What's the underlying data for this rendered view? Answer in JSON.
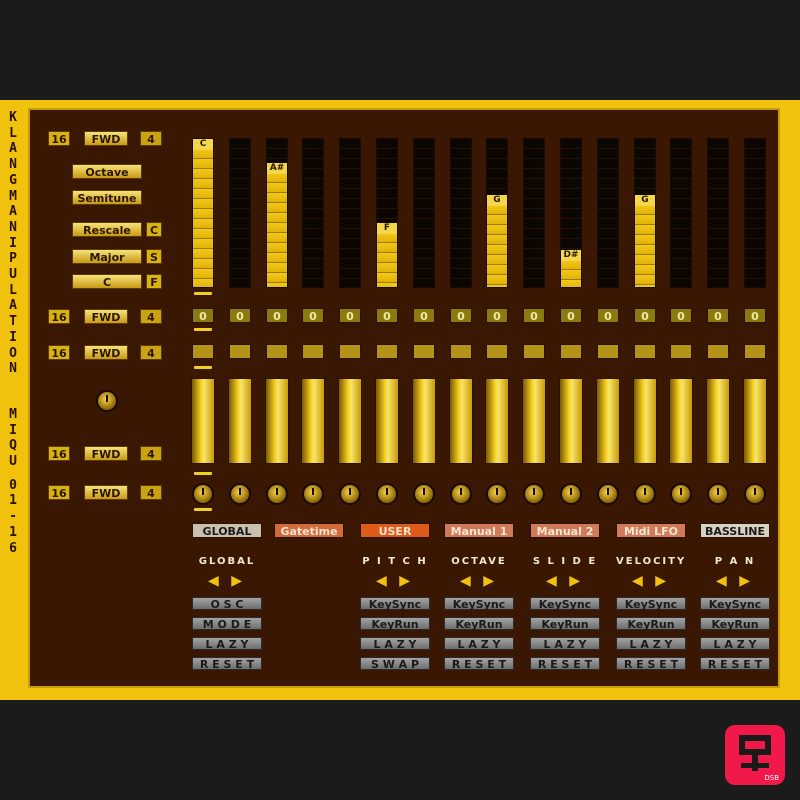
{
  "title_vertical": "KLANGMANIPULATION",
  "subtitle_vertical": "MIQU 01-16",
  "rows": [
    {
      "steps": "16",
      "dir": "FWD",
      "div": "4"
    },
    {
      "steps": "16",
      "dir": "FWD",
      "div": "4"
    },
    {
      "steps": "16",
      "dir": "FWD",
      "div": "4"
    },
    {
      "steps": "16",
      "dir": "FWD",
      "div": "4"
    },
    {
      "steps": "16",
      "dir": "FWD",
      "div": "4"
    }
  ],
  "pitch_controls": {
    "octave": "Octave",
    "semitune": "Semitune",
    "rescale": "Rescale",
    "rescale_key": "C",
    "scale": "Major",
    "scale_key": "S",
    "root": "C",
    "root_key": "F"
  },
  "pitch_steps": [
    {
      "note": "C",
      "level": 1.0
    },
    {
      "note": "",
      "level": 0.0
    },
    {
      "note": "A#",
      "level": 0.84
    },
    {
      "note": "",
      "level": 0.0
    },
    {
      "note": "",
      "level": 0.0
    },
    {
      "note": "F",
      "level": 0.43
    },
    {
      "note": "",
      "level": 0.0
    },
    {
      "note": "",
      "level": 0.0
    },
    {
      "note": "G",
      "level": 0.62
    },
    {
      "note": "",
      "level": 0.0
    },
    {
      "note": "D#",
      "level": 0.25
    },
    {
      "note": "",
      "level": 0.0
    },
    {
      "note": "G",
      "level": 0.62
    },
    {
      "note": "",
      "level": 0.0
    },
    {
      "note": "",
      "level": 0.0
    },
    {
      "note": "",
      "level": 0.0
    }
  ],
  "octave_values": [
    "0",
    "0",
    "0",
    "0",
    "0",
    "0",
    "0",
    "0",
    "0",
    "0",
    "0",
    "0",
    "0",
    "0",
    "0",
    "0"
  ],
  "tabs": [
    {
      "label": "GLOBAL",
      "color": "#c9c0b0",
      "text": "#1a1a1a"
    },
    {
      "label": "Gatetime",
      "color": "#d26a3a",
      "text": "#f4e6d0"
    },
    {
      "label": "USER",
      "color": "#e05a1a",
      "text": "#f4e6d0"
    },
    {
      "label": "Manual 1",
      "color": "#d07a5a",
      "text": "#f4e6d0"
    },
    {
      "label": "Manual 2",
      "color": "#d07a5a",
      "text": "#f4e6d0"
    },
    {
      "label": "Midi LFO",
      "color": "#d07a5a",
      "text": "#f4e6d0"
    },
    {
      "label": "BASSLINE",
      "color": "#d8d0c0",
      "text": "#1a1a1a"
    }
  ],
  "sections": [
    {
      "name": "GLOBAL",
      "buttons": [
        "O S C",
        "M O D E",
        "L A Z Y",
        "R E S E T"
      ]
    },
    {
      "name": "P I T C H",
      "buttons": [
        "KeySync",
        "KeyRun",
        "L A Z Y",
        "S W A P"
      ]
    },
    {
      "name": "OCTAVE",
      "buttons": [
        "KeySync",
        "KeyRun",
        "L A Z Y",
        "R E S E T"
      ]
    },
    {
      "name": "S L I D E",
      "buttons": [
        "KeySync",
        "KeyRun",
        "L A Z Y",
        "R E S E T"
      ]
    },
    {
      "name": "VELOCITY",
      "buttons": [
        "KeySync",
        "KeyRun",
        "L A Z Y",
        "R E S E T"
      ]
    },
    {
      "name": "P A N",
      "buttons": [
        "KeySync",
        "KeyRun",
        "L A Z Y",
        "R E S E T"
      ]
    }
  ],
  "arrow_glyphs": "◀ ▶",
  "colors": {
    "panel": "#3a1703",
    "frame": "#f0c20e",
    "accent": "#f4cf1f"
  },
  "logo_small": "DSB"
}
